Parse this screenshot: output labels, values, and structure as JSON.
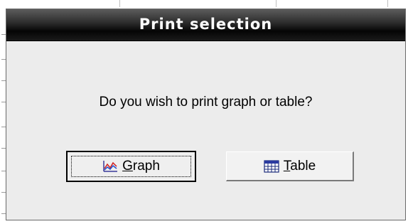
{
  "dialog": {
    "title": "Print selection",
    "message": "Do you wish to print graph or table?",
    "buttons": {
      "graph": {
        "mnemonic": "G",
        "rest": "raph",
        "icon": "line-graph-icon"
      },
      "table": {
        "mnemonic": "T",
        "rest": "able",
        "icon": "table-grid-icon"
      }
    }
  },
  "colors": {
    "titlebar": "#050505",
    "title_text": "#ffffff",
    "dialog_bg": "#ececec"
  }
}
